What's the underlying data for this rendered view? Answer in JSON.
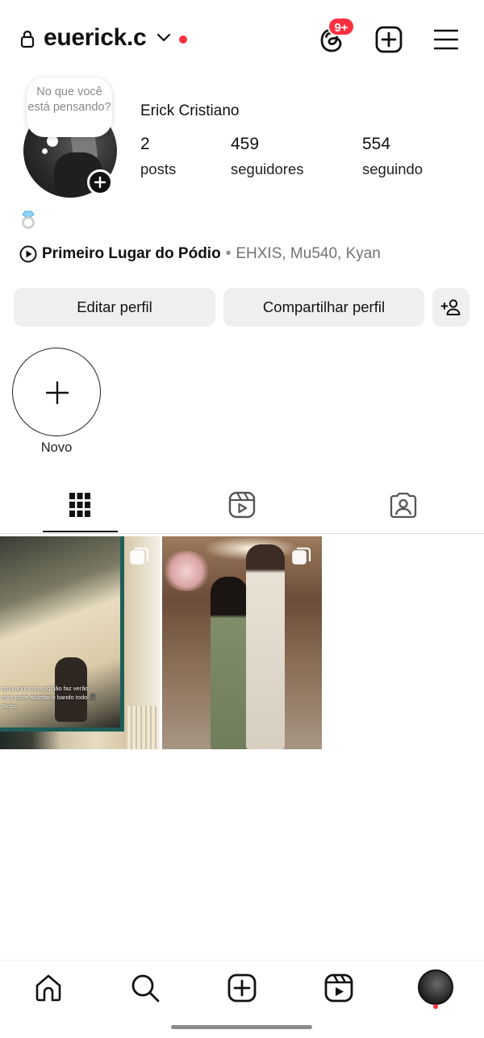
{
  "header": {
    "username": "euerick.c",
    "notification_badge": "9+",
    "accent_color": "#ff3040"
  },
  "profile": {
    "note": "No que você está pensando?",
    "full_name": "Erick Cristiano",
    "stats": [
      {
        "value": "2",
        "label": "posts"
      },
      {
        "value": "459",
        "label": "seguidores"
      },
      {
        "value": "554",
        "label": "seguindo"
      }
    ],
    "bio_emoji": "💍",
    "music": {
      "song": "Primeiro Lugar do Pódio",
      "separator": "•",
      "artists": "EHXIS, Mu540, Kyan"
    }
  },
  "actions": {
    "edit_label": "Editar perfil",
    "share_label": "Compartilhar perfil"
  },
  "highlights": {
    "new_label": "Novo"
  },
  "tabs": [
    {
      "icon": "grid-icon",
      "active": true
    },
    {
      "icon": "reels-icon",
      "active": false
    },
    {
      "icon": "tagged-icon",
      "active": false
    }
  ],
  "posts": [
    {
      "type": "carousel",
      "overlay_text_line1": "uma andorinha só não faz verão,",
      "overlay_text_line2": "mas pode acordar o bando todo 🎵",
      "overlay_text_line3": "Bicho"
    },
    {
      "type": "carousel"
    }
  ],
  "bottom_nav": [
    {
      "icon": "home-icon"
    },
    {
      "icon": "search-icon"
    },
    {
      "icon": "create-icon"
    },
    {
      "icon": "reels-icon"
    },
    {
      "icon": "profile-avatar"
    }
  ]
}
